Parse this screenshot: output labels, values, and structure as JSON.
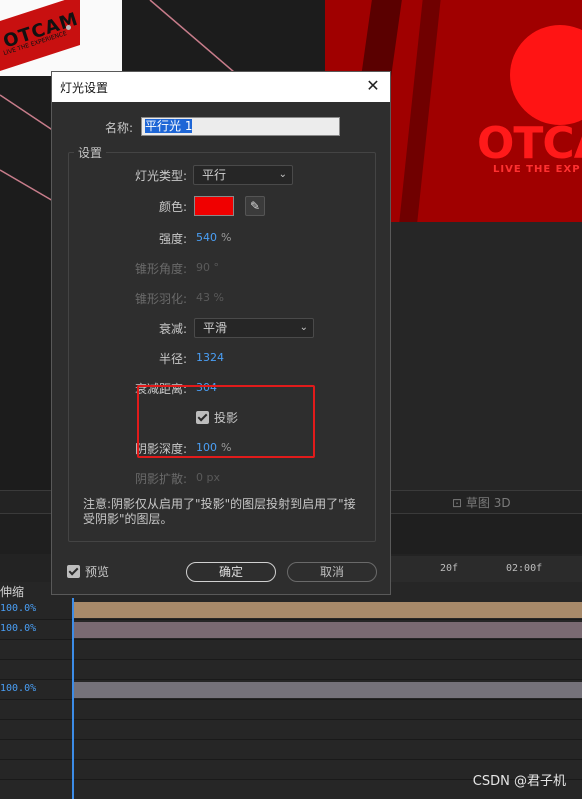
{
  "background": {
    "thumb_text": "OTCAM",
    "thumb_sub": "LIVE THE EXPERIENCE",
    "viewer_logo": "OTCA",
    "viewer_tagline": "LIVE THE EXP",
    "draft3d_label": "草图 3D",
    "time_labels": [
      "20f",
      "02:00f"
    ],
    "stretch_header": "伸缩",
    "layer_values": [
      "100.0%",
      "100.0%",
      "100.0%"
    ],
    "watermark": "CSDN @君子机"
  },
  "dialog": {
    "title": "灯光设置",
    "name_label": "名称:",
    "name_value": "平行光 1",
    "group_title": "设置",
    "light_type_label": "灯光类型:",
    "light_type_value": "平行",
    "color_label": "颜色:",
    "color_value": "#f00000",
    "intensity_label": "强度:",
    "intensity_value": "540",
    "intensity_unit": "%",
    "cone_angle_label": "锥形角度:",
    "cone_angle_value": "90 °",
    "cone_feather_label": "锥形羽化:",
    "cone_feather_value": "43 %",
    "falloff_label": "衰减:",
    "falloff_value": "平滑",
    "radius_label": "半径:",
    "radius_value": "1324",
    "falloff_distance_label": "衰减距离:",
    "falloff_distance_value": "304",
    "cast_shadows_label": "投影",
    "shadow_darkness_label": "阴影深度:",
    "shadow_darkness_value": "100",
    "shadow_darkness_unit": "%",
    "shadow_diffusion_label": "阴影扩散:",
    "shadow_diffusion_value": "0 px",
    "note": "注意:阴影仅从启用了\"投影\"的图层投射到启用了\"接受阴影\"的图层。",
    "preview_label": "预览",
    "ok_label": "确定",
    "cancel_label": "取消"
  },
  "colors": {
    "accent_blue": "#4a9ff5",
    "highlight_red": "#e11b1b"
  }
}
